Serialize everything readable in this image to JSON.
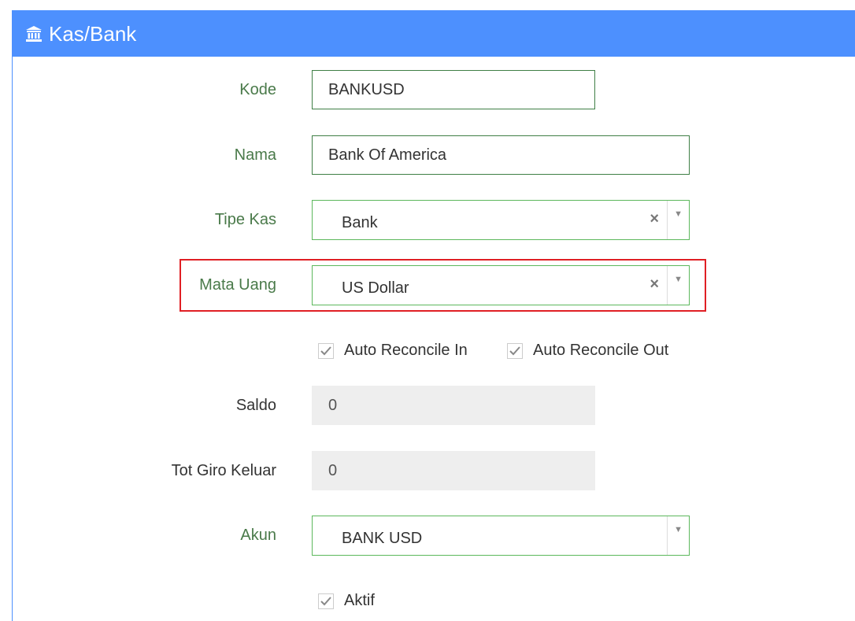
{
  "header": {
    "icon": "bank-icon",
    "title": "Kas/Bank"
  },
  "form": {
    "kode": {
      "label": "Kode",
      "value": "BANKUSD"
    },
    "nama": {
      "label": "Nama",
      "value": "Bank Of America"
    },
    "tipe_kas": {
      "label": "Tipe Kas",
      "value": "Bank",
      "clear": "×",
      "caret": "▼"
    },
    "mata_uang": {
      "label": "Mata Uang",
      "value": "US Dollar",
      "clear": "×",
      "caret": "▼"
    },
    "auto_reconcile_in": {
      "label": "Auto Reconcile In",
      "checked": true
    },
    "auto_reconcile_out": {
      "label": "Auto Reconcile Out",
      "checked": true
    },
    "saldo": {
      "label": "Saldo",
      "value": "0"
    },
    "tot_giro_keluar": {
      "label": "Tot Giro Keluar",
      "value": "0"
    },
    "akun": {
      "label": "Akun",
      "value": "BANK USD",
      "caret": "▼"
    },
    "aktif": {
      "label": "Aktif",
      "checked": true
    }
  },
  "colors": {
    "header_bg": "#4d90fe",
    "label_green": "#4a7a4a",
    "input_border": "#3f7f46",
    "select_border": "#5cb85c",
    "highlight_red": "#e01f24",
    "readonly_bg": "#eeeeee"
  }
}
